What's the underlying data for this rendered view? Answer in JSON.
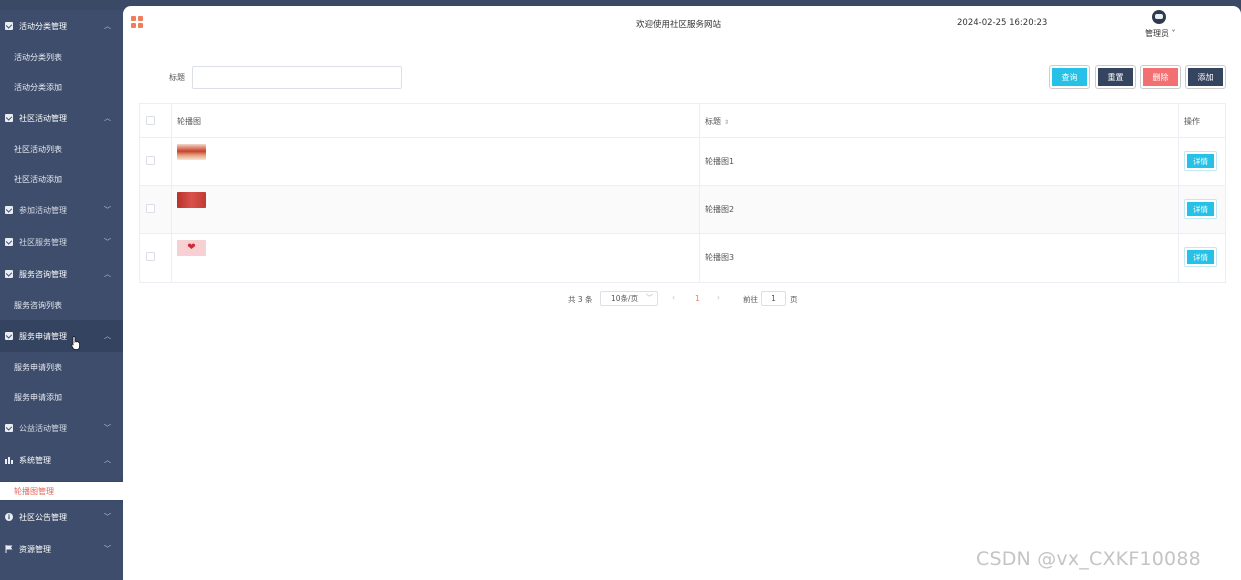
{
  "sidebar": {
    "groups": [
      {
        "label": "活动分类管理",
        "icon": "check-square-icon",
        "open": true,
        "items": [
          "活动分类列表",
          "活动分类添加"
        ]
      },
      {
        "label": "社区活动管理",
        "icon": "check-square-icon",
        "open": true,
        "items": [
          "社区活动列表",
          "社区活动添加"
        ]
      },
      {
        "label": "参加活动管理",
        "icon": "check-square-icon",
        "open": false,
        "items": []
      },
      {
        "label": "社区服务管理",
        "icon": "check-square-icon",
        "open": false,
        "items": []
      },
      {
        "label": "服务咨询管理",
        "icon": "check-square-icon",
        "open": true,
        "items": [
          "服务咨询列表"
        ]
      },
      {
        "label": "服务申请管理",
        "icon": "check-square-icon",
        "open": true,
        "items": [
          "服务申请列表",
          "服务申请添加"
        ]
      },
      {
        "label": "公益活动管理",
        "icon": "check-square-icon",
        "open": false,
        "items": []
      },
      {
        "label": "系统管理",
        "icon": "bar-chart-icon",
        "open": true,
        "items": []
      }
    ],
    "active_item": "轮播图管理",
    "bottom_groups": [
      {
        "label": "社区公告管理",
        "icon": "info-icon"
      },
      {
        "label": "资源管理",
        "icon": "flag-icon"
      }
    ]
  },
  "header": {
    "site_title": "欢迎使用社区服务网站",
    "datetime": "2024-02-25 16:20:23",
    "user": "管理员 ˅"
  },
  "search": {
    "label": "标题",
    "value": "",
    "buttons": {
      "query": "查询",
      "reset": "重置",
      "delete": "删除",
      "add": "添加"
    }
  },
  "table": {
    "columns": [
      "轮播图",
      "标题",
      "操作"
    ],
    "sort_glyph": "⇕",
    "rows": [
      {
        "title": "轮播图1",
        "action": "详情"
      },
      {
        "title": "轮播图2",
        "action": "详情"
      },
      {
        "title": "轮播图3",
        "action": "详情"
      }
    ]
  },
  "pager": {
    "total": "共 3 条",
    "page_size": "10条/页",
    "current": "1",
    "goto": "前往",
    "goto_value": "1",
    "page_suffix": "页"
  },
  "colors": {
    "accent": "#25c1e6",
    "danger": "#f26f72",
    "dark": "#36455f",
    "sidebar": "#3e4d6b",
    "active": "#e6645a"
  },
  "watermark": "CSDN @vx_CXKF10088"
}
